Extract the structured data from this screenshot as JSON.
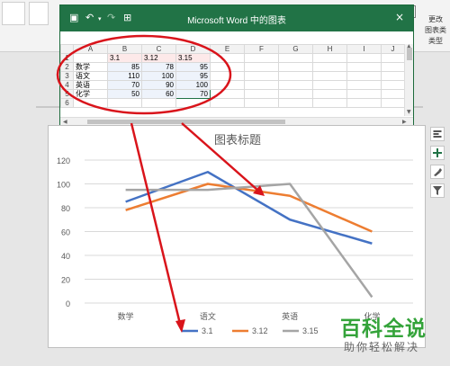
{
  "ribbon": {
    "side_label_1": "更改",
    "side_label_2": "图表类",
    "side_label_3": "类型"
  },
  "excel": {
    "title": "Microsoft Word 中的图表",
    "undo_icon": "undo-icon",
    "redo_icon": "redo-icon",
    "edit_icon": "edit-data-icon",
    "close_glyph": "×",
    "columns": [
      "A",
      "B",
      "C",
      "D",
      "E",
      "F",
      "G",
      "H",
      "I",
      "J"
    ],
    "rows": [
      {
        "num": "1",
        "cells": [
          "",
          "3.1",
          "3.12",
          "3.15"
        ]
      },
      {
        "num": "2",
        "cells": [
          "数学",
          "85",
          "78",
          "95"
        ]
      },
      {
        "num": "3",
        "cells": [
          "语文",
          "110",
          "100",
          "95"
        ]
      },
      {
        "num": "4",
        "cells": [
          "英语",
          "70",
          "90",
          "100"
        ]
      },
      {
        "num": "5",
        "cells": [
          "化学",
          "50",
          "60",
          "70"
        ]
      },
      {
        "num": "6",
        "cells": [
          "",
          "",
          "",
          ""
        ]
      }
    ]
  },
  "chart_data": {
    "type": "line",
    "title": "图表标题",
    "categories": [
      "数学",
      "语文",
      "英语",
      "化学"
    ],
    "series": [
      {
        "name": "3.1",
        "values": [
          85,
          110,
          70,
          50
        ],
        "color": "#4472c4"
      },
      {
        "name": "3.12",
        "values": [
          78,
          100,
          90,
          60
        ],
        "color": "#ed7d31"
      },
      {
        "name": "3.15",
        "values": [
          95,
          95,
          100,
          5
        ],
        "color": "#a5a5a5"
      }
    ],
    "yticks": [
      "0",
      "20",
      "40",
      "60",
      "80",
      "100",
      "120"
    ],
    "ylim": [
      0,
      120
    ],
    "grid": true,
    "legend": "bottom"
  },
  "tools": [
    "layout-options-icon",
    "chart-elements-icon",
    "chart-styles-icon",
    "chart-filter-icon"
  ],
  "watermark": {
    "line1": "百科全说",
    "line2": "助你轻松解决"
  },
  "annotation_color": "#d9141b"
}
